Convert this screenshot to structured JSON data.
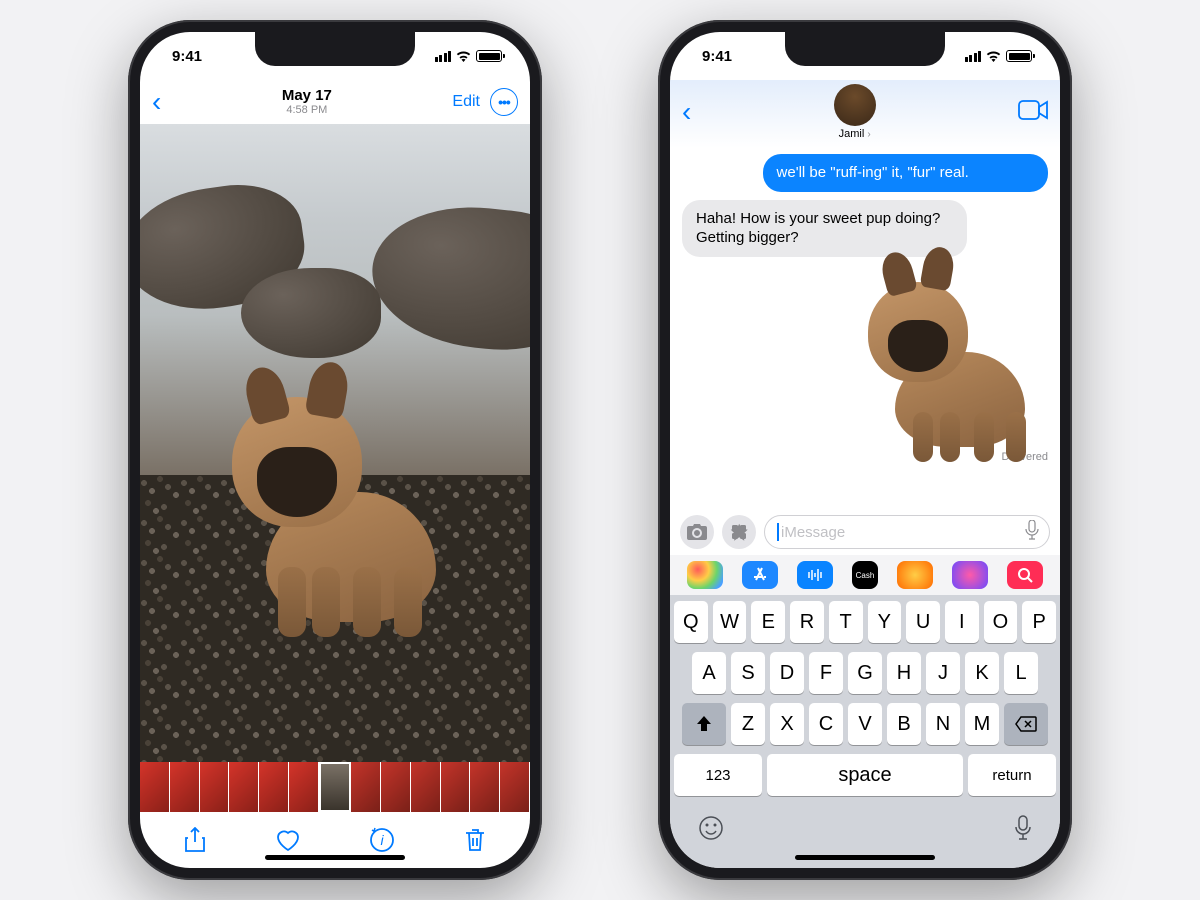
{
  "status": {
    "time": "9:41"
  },
  "photos": {
    "date": "May 17",
    "time": "4:58 PM",
    "edit_label": "Edit"
  },
  "messages": {
    "contact_name": "Jamil",
    "sent_preview": "we'll be \"ruff-ing\" it, \"fur\" real.",
    "received": "Haha! How is your sweet pup doing? Getting bigger?",
    "delivered_label": "Delivered",
    "input_placeholder": "iMessage",
    "apple_cash_label": "Cash"
  },
  "keyboard": {
    "row1": [
      "Q",
      "W",
      "E",
      "R",
      "T",
      "Y",
      "U",
      "I",
      "O",
      "P"
    ],
    "row2": [
      "A",
      "S",
      "D",
      "F",
      "G",
      "H",
      "J",
      "K",
      "L"
    ],
    "row3": [
      "Z",
      "X",
      "C",
      "V",
      "B",
      "N",
      "M"
    ],
    "numbers_label": "123",
    "space_label": "space",
    "return_label": "return"
  }
}
